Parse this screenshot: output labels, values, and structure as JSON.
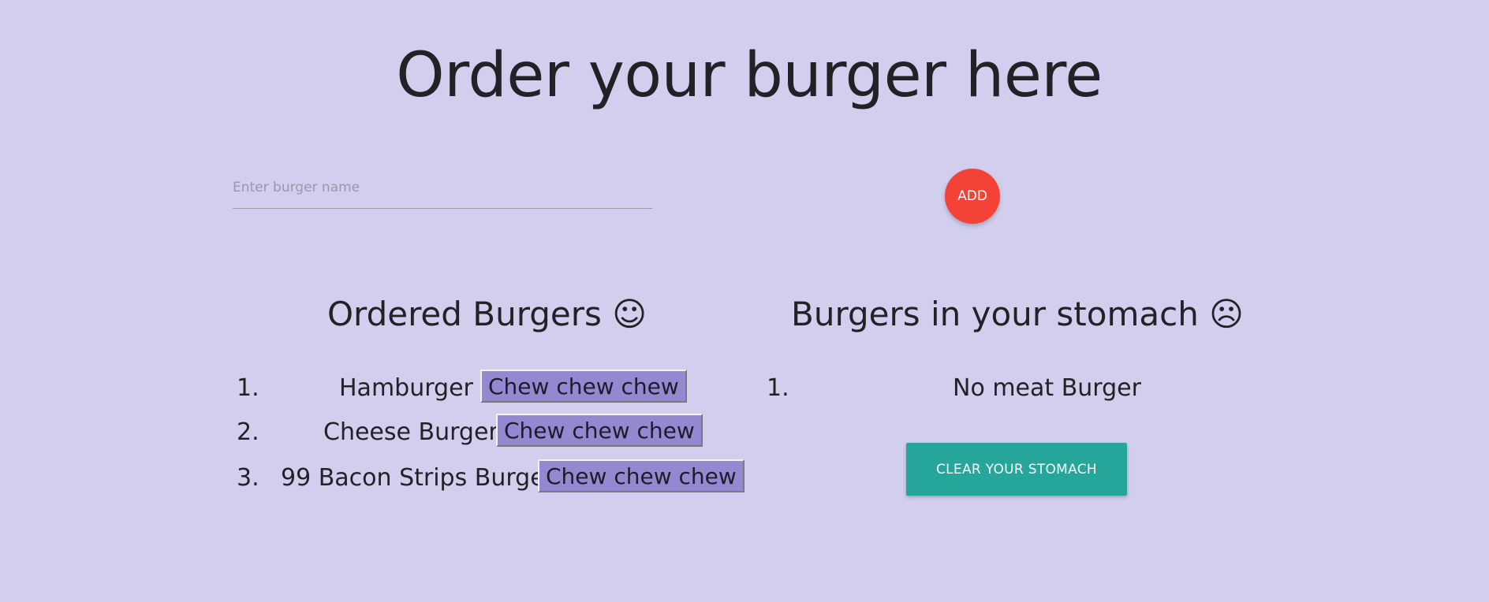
{
  "header": {
    "title": "Order your burger here"
  },
  "form": {
    "input_placeholder": "Enter burger name",
    "input_value": "",
    "add_label": "ADD"
  },
  "ordered": {
    "title": "Ordered Burgers ☺",
    "items": [
      {
        "number": "1.",
        "name": "Hamburger",
        "button_label": "Chew chew chew"
      },
      {
        "number": "2.",
        "name": "Cheese Burger",
        "button_label": "Chew chew chew"
      },
      {
        "number": "3.",
        "name": "99 Bacon Strips Burger",
        "button_label": "Chew chew chew"
      }
    ]
  },
  "stomach": {
    "title": "Burgers in your stomach ☹",
    "items": [
      {
        "number": "1.",
        "name": "No meat Burger"
      }
    ],
    "clear_label": "CLEAR YOUR STOMACH"
  },
  "colors": {
    "background": "#d2cfee",
    "add_button": "#f44336",
    "chew_button": "#9488d1",
    "clear_button": "#26a69a"
  }
}
